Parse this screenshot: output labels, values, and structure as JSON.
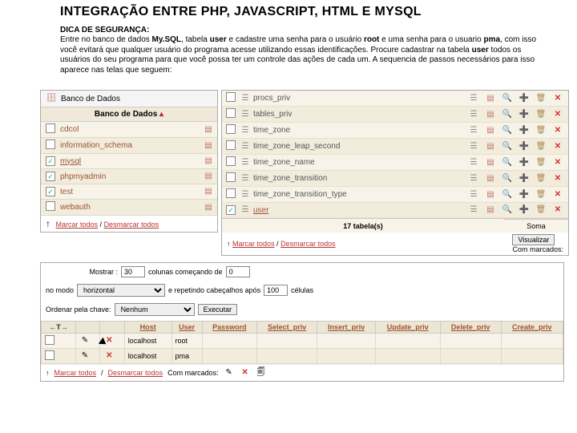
{
  "header": {
    "title": "INTEGRAÇÃO ENTRE PHP, JAVASCRIPT, HTML E MYSQL",
    "subtitle": "DICA DE SEGURANÇA:",
    "body1a": "Entre no banco de dados ",
    "body1b": "My.SQL",
    "body1c": ", tabela ",
    "body1d": "user",
    "body1e": " e cadastre uma senha para o usuário ",
    "body1f": "root",
    "body1g": " e uma senha para o usuario ",
    "body1h": "pma",
    "body1i": ", com isso você evitará que qualquer usuário do programa acesse utilizando essas identificações. Procure cadastrar na tabela ",
    "body1j": "user",
    "body1k": " todos os usuários do seu programa para que você possa ter um controle das ações de cada um. A sequencia de passos necessários para isso aparece nas telas que seguem:"
  },
  "panel1": {
    "header": "Banco de Dados",
    "subhead": "Banco de Dados",
    "rows": [
      {
        "name": "cdcol",
        "checked": false,
        "alt": false
      },
      {
        "name": "information_schema",
        "checked": false,
        "alt": true
      },
      {
        "name": "mysql",
        "checked": true,
        "alt": false,
        "underline": true
      },
      {
        "name": "phpmyadmin",
        "checked": true,
        "alt": true
      },
      {
        "name": "test",
        "checked": true,
        "alt": false
      },
      {
        "name": "webauth",
        "checked": false,
        "alt": true
      }
    ],
    "footer_mark": "Marcar todos",
    "footer_sep": " / ",
    "footer_unmark": "Desmarcar todos"
  },
  "panel2": {
    "rows": [
      {
        "name": "procs_priv",
        "checked": false,
        "alt": false
      },
      {
        "name": "tables_priv",
        "checked": false,
        "alt": true
      },
      {
        "name": "time_zone",
        "checked": false,
        "alt": false
      },
      {
        "name": "time_zone_leap_second",
        "checked": false,
        "alt": true
      },
      {
        "name": "time_zone_name",
        "checked": false,
        "alt": false
      },
      {
        "name": "time_zone_transition",
        "checked": false,
        "alt": true
      },
      {
        "name": "time_zone_transition_type",
        "checked": false,
        "alt": false
      },
      {
        "name": "user",
        "checked": true,
        "alt": true,
        "underline": true
      }
    ],
    "sum_label": "17 tabela(s)",
    "sum_right": "Soma",
    "btn_visualize": "Visualizar",
    "with_marked": "Com marcados:",
    "footer_mark": "Marcar todos",
    "footer_sep": " / ",
    "footer_unmark": "Desmarcar todos"
  },
  "panel3": {
    "show_label": "Mostrar :",
    "show_val": "30",
    "cols_label": "colunas começando de",
    "cols_val": "0",
    "mode_label": "no modo",
    "mode_val": "horizontal",
    "repeat_label": "e repetindo cabeçalhos após",
    "repeat_val": "100",
    "cells_label": "células",
    "sort_label": "Ordenar pela chave:",
    "sort_val": "Nenhum",
    "sort_btn": "Executar",
    "cols": [
      "Host",
      "User",
      "Password",
      "Select_priv",
      "Insert_priv",
      "Update_priv",
      "Delete_priv",
      "Create_priv"
    ],
    "rows": [
      {
        "host": "localhost",
        "user": "root",
        "pw": "",
        "sp": "",
        "ip": "",
        "up": "",
        "dp": "",
        "cp": "",
        "checked": false
      },
      {
        "host": "localhost",
        "user": "pma",
        "pw": "",
        "sp": "",
        "ip": "",
        "up": "",
        "dp": "",
        "cp": "",
        "checked": false
      }
    ],
    "footer_mark": "Marcar todos",
    "footer_sep": " / ",
    "footer_unmark": "Desmarcar todos",
    "with_marked": "Com marcados:"
  }
}
